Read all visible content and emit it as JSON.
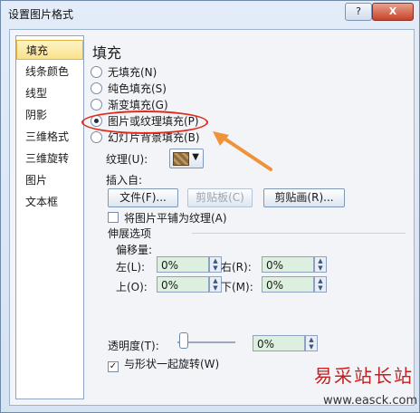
{
  "window": {
    "title": "设置图片格式",
    "help_label": "?",
    "close_label": "X"
  },
  "sidebar": {
    "items": [
      {
        "label": "填充",
        "active": true
      },
      {
        "label": "线条颜色",
        "active": false
      },
      {
        "label": "线型",
        "active": false
      },
      {
        "label": "阴影",
        "active": false
      },
      {
        "label": "三维格式",
        "active": false
      },
      {
        "label": "三维旋转",
        "active": false
      },
      {
        "label": "图片",
        "active": false
      },
      {
        "label": "文本框",
        "active": false
      }
    ]
  },
  "fill": {
    "title": "填充",
    "options": [
      {
        "label": "无填充(N)",
        "selected": false
      },
      {
        "label": "纯色填充(S)",
        "selected": false
      },
      {
        "label": "渐变填充(G)",
        "selected": false
      },
      {
        "label": "图片或纹理填充(P)",
        "selected": true
      },
      {
        "label": "幻灯片背景填充(B)",
        "selected": false
      }
    ],
    "texture_label": "纹理(U):",
    "insert_from_label": "插入自:",
    "file_button": "文件(F)...",
    "clipboard_button": "剪贴板(C)",
    "clipart_button": "剪贴画(R)...",
    "tile_checkbox_label": "将图片平铺为纹理(A)",
    "tile_checked": false,
    "stretch_section": "伸展选项",
    "offset_label": "偏移量:",
    "left_label": "左(L):",
    "left_value": "0%",
    "right_label": "右(R):",
    "right_value": "0%",
    "top_label": "上(O):",
    "top_value": "0%",
    "bottom_label": "下(M):",
    "bottom_value": "0%",
    "transparency_label": "透明度(T):",
    "transparency_value": "0%",
    "rotate_with_shape_label": "与形状一起旋转(W)",
    "rotate_with_shape_checked": true
  },
  "watermark": {
    "site_name": "易采站长站",
    "site_url": "www.easck.com"
  },
  "colors": {
    "highlight": "#e02b1c",
    "arrow": "#f0923a",
    "watermark": "#c41f1f"
  }
}
